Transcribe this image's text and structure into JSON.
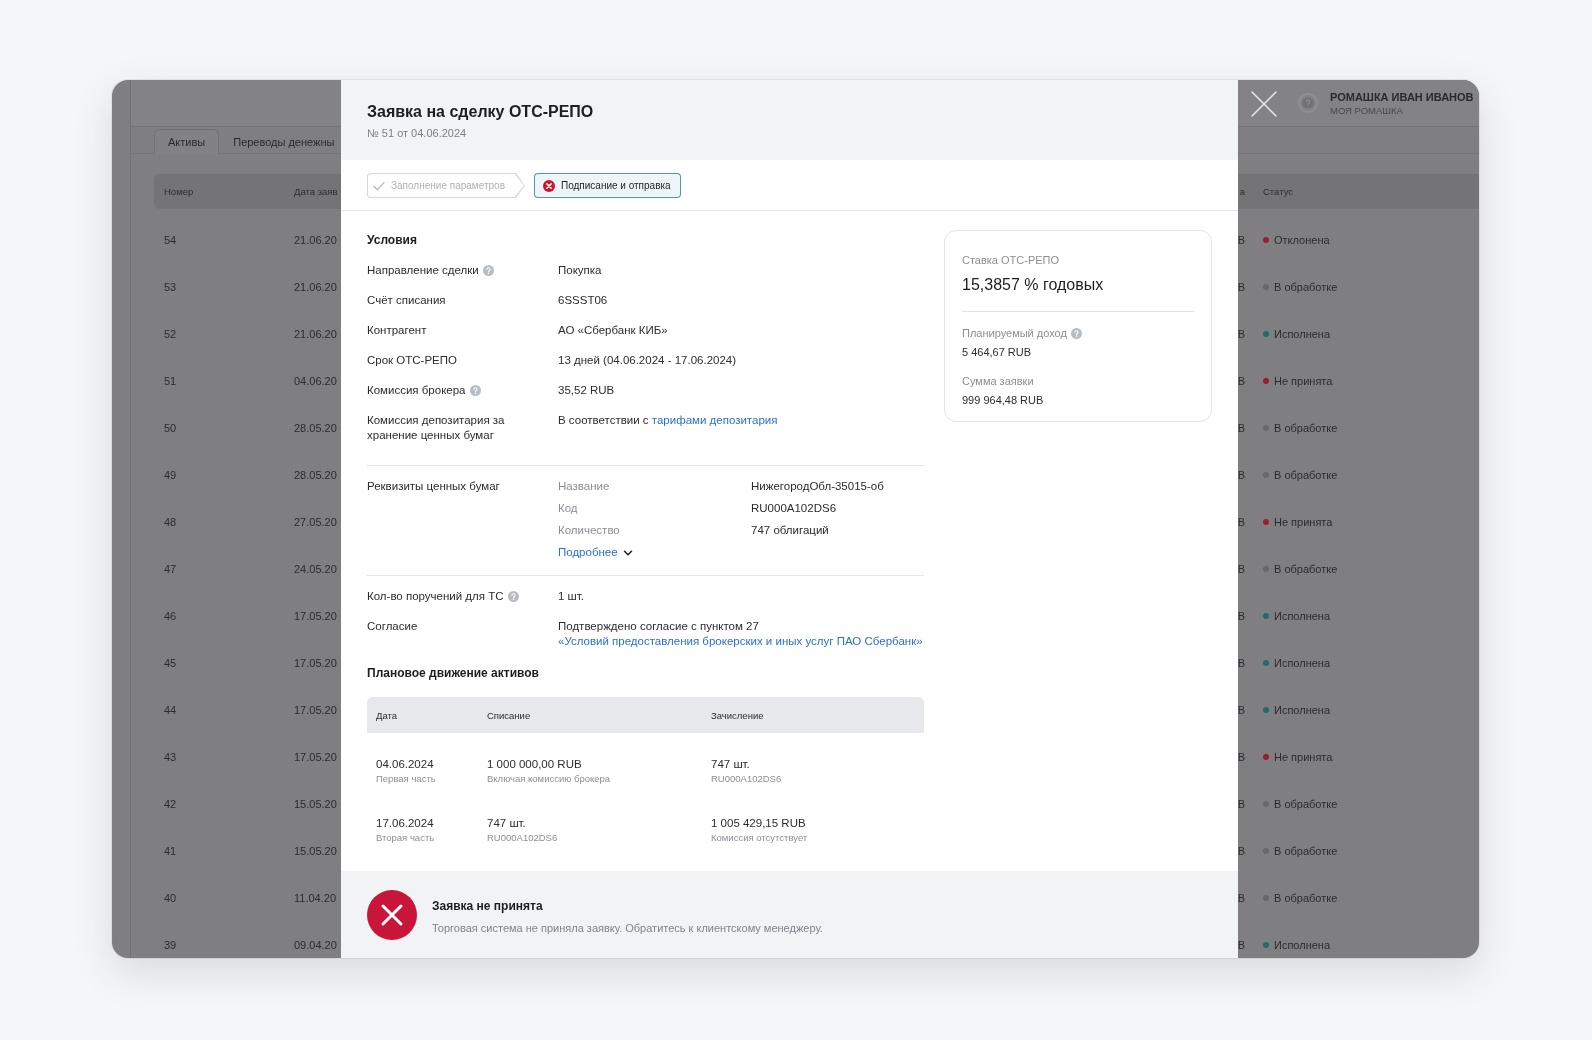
{
  "background_app": {
    "header": {
      "user_name": "РОМАШКА ИВАН ИВАНОВ",
      "user_org": "МОЯ РОМАШКА"
    },
    "tabs": [
      {
        "label": "Активы",
        "selected": true
      },
      {
        "label": "Переводы денежны",
        "selected": false
      }
    ],
    "table": {
      "columns": [
        "Номер",
        "Дата заяв",
        "а",
        "Статус"
      ],
      "rows": [
        {
          "number": "54",
          "date": "21.06.20",
          "column_3": "B",
          "status": "Отклонена",
          "color": "#9b1c35"
        },
        {
          "number": "53",
          "date": "21.06.20",
          "column_3": "B",
          "status": "В обработке",
          "color": "#67686c"
        },
        {
          "number": "52",
          "date": "21.06.20",
          "column_3": "B",
          "status": "Исполнена",
          "color": "#1e6e66"
        },
        {
          "number": "51",
          "date": "04.06.20",
          "column_3": "B",
          "status": "Не принята",
          "color": "#9b1c35"
        },
        {
          "number": "50",
          "date": "28.05.20",
          "column_3": "B",
          "status": "В обработке",
          "color": "#67686c"
        },
        {
          "number": "49",
          "date": "28.05.20",
          "column_3": "B",
          "status": "В обработке",
          "color": "#67686c"
        },
        {
          "number": "48",
          "date": "27.05.20",
          "column_3": "B",
          "status": "Не принята",
          "color": "#9b1c35"
        },
        {
          "number": "47",
          "date": "24.05.20",
          "column_3": "B",
          "status": "В обработке",
          "color": "#67686c"
        },
        {
          "number": "46",
          "date": "17.05.20",
          "column_3": "B",
          "status": "Исполнена",
          "color": "#1e6e66"
        },
        {
          "number": "45",
          "date": "17.05.20",
          "column_3": "B",
          "status": "Исполнена",
          "color": "#1e6e66"
        },
        {
          "number": "44",
          "date": "17.05.20",
          "column_3": "B",
          "status": "Исполнена",
          "color": "#1e6e66"
        },
        {
          "number": "43",
          "date": "17.05.20",
          "column_3": "B",
          "status": "Не принята",
          "color": "#9b1c35"
        },
        {
          "number": "42",
          "date": "15.05.20",
          "column_3": "B",
          "status": "В обработке",
          "color": "#67686c"
        },
        {
          "number": "41",
          "date": "15.05.20",
          "column_3": "B",
          "status": "В обработке",
          "color": "#67686c"
        },
        {
          "number": "40",
          "date": "11.04.20",
          "column_3": "B",
          "status": "В обработке",
          "color": "#67686c"
        },
        {
          "number": "39",
          "date": "09.04.20",
          "column_3": "B",
          "status": "Исполнена",
          "color": "#1e6e66"
        }
      ]
    }
  },
  "modal": {
    "title": "Заявка на сделку ОТС-РЕПО",
    "subtitle": "№ 51 от 04.06.2024",
    "steps": [
      {
        "label": "Заполнение параметров",
        "kind": "done",
        "selected": false
      },
      {
        "label": "Подписание и отправка",
        "kind": "error",
        "selected": true
      }
    ],
    "conditions": {
      "title": "Условия",
      "rows": [
        {
          "label": "Направление сделки",
          "help": true,
          "value": "Покупка"
        },
        {
          "label": "Счёт списания",
          "help": false,
          "value": "6SSST06"
        },
        {
          "label": "Контрагент",
          "help": false,
          "value": "АО «Сбербанк КИБ»"
        },
        {
          "label": "Срок ОТС-РЕПО",
          "help": false,
          "value": "13 дней (04.06.2024 - 17.06.2024)"
        },
        {
          "label": "Комиссия брокера",
          "help": true,
          "value": "35,52 RUB"
        },
        {
          "label": "Комиссия депозитария за хранение ценных бумаг",
          "help": false,
          "value": "В соответствии с",
          "link": "тарифами депозитария"
        }
      ]
    },
    "securities": {
      "label": "Реквизиты ценных бумаг",
      "fields": [
        {
          "label": "Название",
          "value": "НижегородОбл-35015-об"
        },
        {
          "label": "Код",
          "value": "RU000A102DS6"
        },
        {
          "label": "Количество",
          "value": "747 облигаций"
        }
      ],
      "more_link": "Подробнее",
      "expanded": false
    },
    "details": [
      {
        "label": "Кол-во поручений для ТС",
        "help": true,
        "value": "1 шт."
      },
      {
        "label": "Согласие",
        "help": false,
        "value": "Подтверждено согласие с пунктом 27",
        "link": "«Условий предоставления брокерских и иных услуг ПАО Сбербанк»"
      }
    ],
    "plan": {
      "title": "Плановое движение активов",
      "columns": [
        "Дата",
        "Списание",
        "Зачисление"
      ],
      "rows": [
        {
          "cells": [
            {
              "value": "04.06.2024",
              "note": "Первая часть"
            },
            {
              "value": "1 000 000,00 RUB",
              "note": "Включая комиссию брокера"
            },
            {
              "value": "747 шт.",
              "note": "RU000A102DS6"
            }
          ]
        },
        {
          "cells": [
            {
              "value": "17.06.2024",
              "note": "Вторая часть"
            },
            {
              "value": "747 шт.",
              "note": "RU000A102DS6"
            },
            {
              "value": "1 005 429,15 RUB",
              "note": "Комиссия отсутствует"
            }
          ]
        }
      ]
    },
    "rate_card": {
      "title": "Ставка ОТС-РЕПО",
      "rate": "15,3857 % годовых",
      "items": [
        {
          "label": "Планируемый доход",
          "help": true,
          "value": "5 464,67 RUB"
        },
        {
          "label": "Сумма заявки",
          "help": false,
          "value": "999 964,48 RUB"
        }
      ]
    },
    "result": {
      "kind": "error",
      "title": "Заявка не принята",
      "text": "Торговая система не приняла заявку. Обратитесь к клиентскому менеджеру."
    }
  }
}
